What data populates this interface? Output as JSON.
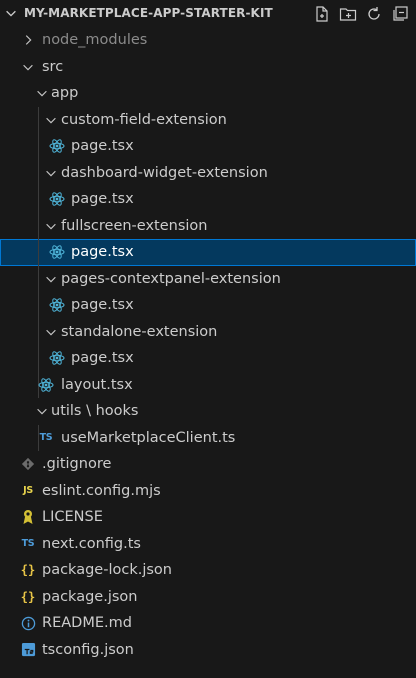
{
  "explorer": {
    "project_title": "MY-MARKETPLACE-APP-STARTER-KIT",
    "actions": [
      {
        "name": "new-file-icon"
      },
      {
        "name": "new-folder-icon"
      },
      {
        "name": "refresh-icon"
      },
      {
        "name": "collapse-all-icon"
      }
    ]
  },
  "tree": [
    {
      "label": "node_modules",
      "kind": "folder",
      "expanded": false,
      "depth": 1,
      "dim": true
    },
    {
      "label": "src",
      "kind": "folder",
      "expanded": true,
      "depth": 1
    },
    {
      "label": "app",
      "kind": "folder",
      "expanded": true,
      "depth": 2
    },
    {
      "label": "custom-field-extension",
      "kind": "folder",
      "expanded": true,
      "depth": 3
    },
    {
      "label": "page.tsx",
      "kind": "react",
      "depth": 4
    },
    {
      "label": "dashboard-widget-extension",
      "kind": "folder",
      "expanded": true,
      "depth": 3
    },
    {
      "label": "page.tsx",
      "kind": "react",
      "depth": 4
    },
    {
      "label": "fullscreen-extension",
      "kind": "folder",
      "expanded": true,
      "depth": 3
    },
    {
      "label": "page.tsx",
      "kind": "react",
      "depth": 4,
      "selected": true
    },
    {
      "label": "pages-contextpanel-extension",
      "kind": "folder",
      "expanded": true,
      "depth": 3
    },
    {
      "label": "page.tsx",
      "kind": "react",
      "depth": 4
    },
    {
      "label": "standalone-extension",
      "kind": "folder",
      "expanded": true,
      "depth": 3
    },
    {
      "label": "page.tsx",
      "kind": "react",
      "depth": 4
    },
    {
      "label": "layout.tsx",
      "kind": "react",
      "depth": 3
    },
    {
      "label": "utils \\ hooks",
      "kind": "folder",
      "expanded": true,
      "depth": 2
    },
    {
      "label": "useMarketplaceClient.ts",
      "kind": "ts",
      "depth": 3
    },
    {
      "label": ".gitignore",
      "kind": "git",
      "depth": 1
    },
    {
      "label": "eslint.config.mjs",
      "kind": "js",
      "depth": 1
    },
    {
      "label": "LICENSE",
      "kind": "license",
      "depth": 1
    },
    {
      "label": "next.config.ts",
      "kind": "ts",
      "depth": 1
    },
    {
      "label": "package-lock.json",
      "kind": "json",
      "depth": 1
    },
    {
      "label": "package.json",
      "kind": "json",
      "depth": 1
    },
    {
      "label": "README.md",
      "kind": "info",
      "depth": 1
    },
    {
      "label": "tsconfig.json",
      "kind": "tsconfig",
      "depth": 1
    }
  ],
  "badges": {
    "ts": "TS",
    "js": "JS",
    "json": "{}"
  },
  "colors": {
    "background": "#181818",
    "selection": "#04395e",
    "selection_border": "#0078d4",
    "react_icon": "#4fb4d8",
    "ts_icon": "#4d9bd8",
    "js_icon": "#e8d44d",
    "json_icon": "#e8c547",
    "license_icon": "#d4c035",
    "info_icon": "#4d9bd8",
    "git_icon": "#6b6b6b"
  }
}
